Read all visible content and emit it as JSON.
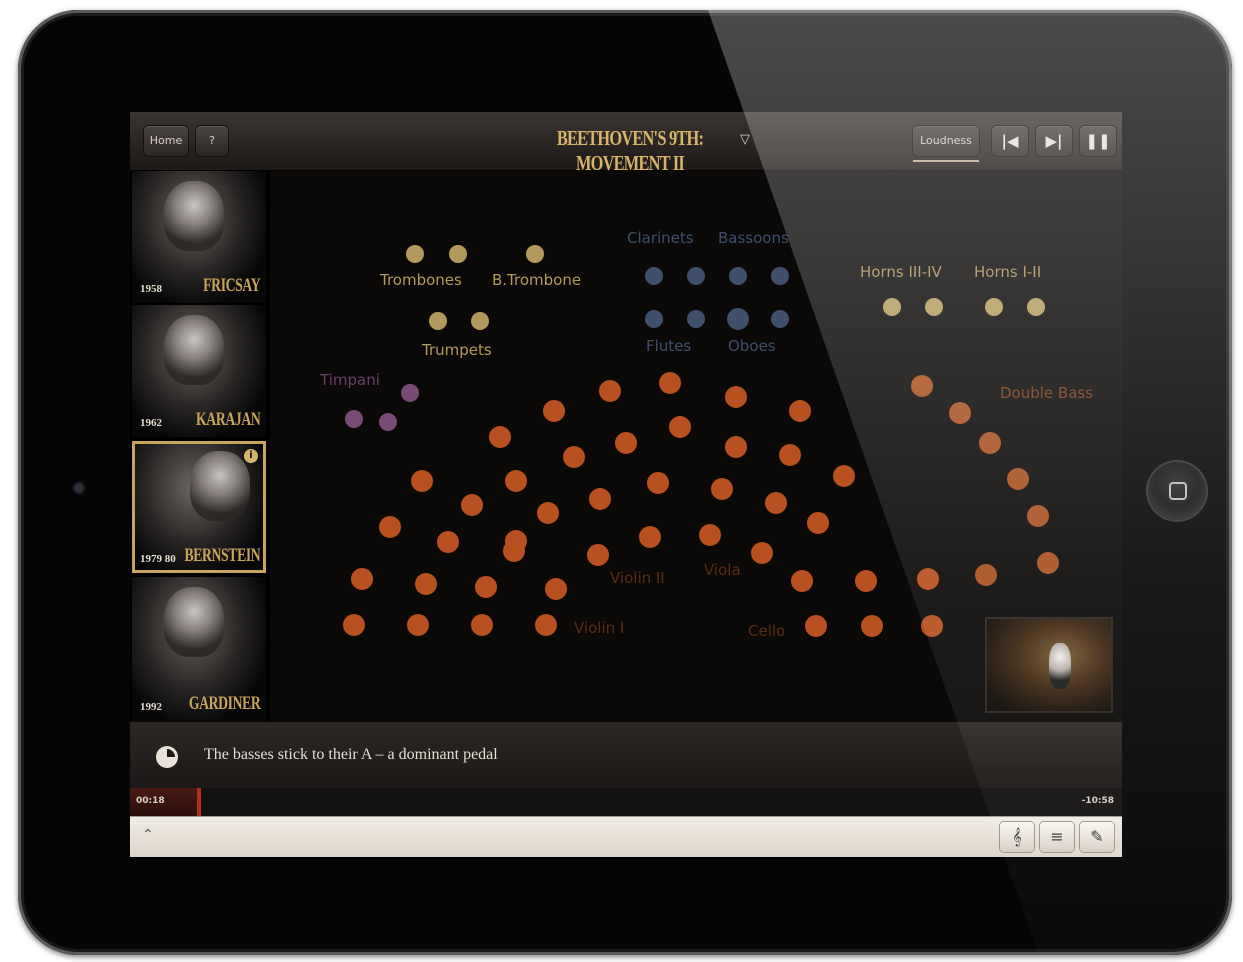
{
  "topbar": {
    "home_label": "Home",
    "help_label": "?",
    "title": "BEETHOVEN'S 9TH: MOVEMENT II",
    "title_chevron": "chevron-down-icon",
    "loudness_label": "Loudness",
    "prev_icon": "skip-back-icon",
    "next_icon": "skip-forward-icon",
    "pause_icon": "pause-icon"
  },
  "conductors": [
    {
      "year": "1958",
      "name": "FRICSAY"
    },
    {
      "year": "1962",
      "name": "KARAJAN"
    },
    {
      "year": "1979 80",
      "name": "BERNSTEIN",
      "active": true
    },
    {
      "year": "1992",
      "name": "GARDINER"
    }
  ],
  "stage": {
    "labels": {
      "trombones": "Trombones",
      "b_trombone": "B.Trombone",
      "trumpets": "Trumpets",
      "clarinets": "Clarinets",
      "bassoons": "Bassoons",
      "flutes": "Flutes",
      "oboes": "Oboes",
      "horns_3_4": "Horns III-IV",
      "horns_1_2": "Horns I-II",
      "timpani": "Timpani",
      "double_bass": "Double Bass",
      "violin_2": "Violin II",
      "viola": "Viola",
      "violin_1": "Violin I",
      "cello": "Cello"
    },
    "colors": {
      "brass": "#b39a5c",
      "woodwinds": "#3f4f6c",
      "timpani": "#7a4a76",
      "strings": "#b8501f",
      "bass": "#a8501f"
    }
  },
  "caption": {
    "text": "The basses stick to their A – a dominant pedal",
    "icon": "clock-pie-icon"
  },
  "timeline": {
    "elapsed": "00:18",
    "remaining": "-10:58",
    "progress": 0.07
  },
  "notes_bar": {
    "expand_icon": "chevron-up-icon",
    "tools": [
      "treble-clef-icon",
      "score-layout-icon",
      "pen-icon"
    ]
  }
}
